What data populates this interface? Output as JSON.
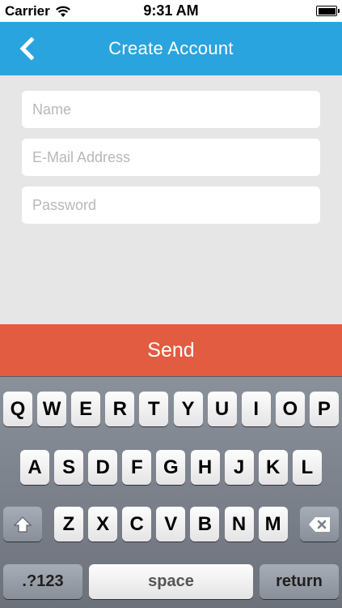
{
  "status_bar": {
    "carrier": "Carrier",
    "time": "9:31 AM",
    "wifi_icon": "wifi-icon",
    "battery_icon": "battery-icon",
    "battery_level": 1.0
  },
  "nav": {
    "title": "Create Account",
    "back_icon": "back-chevron-icon",
    "color": "#2aa4de"
  },
  "form": {
    "name": {
      "placeholder": "Name",
      "value": ""
    },
    "email": {
      "placeholder": "E-Mail Address",
      "value": ""
    },
    "password": {
      "placeholder": "Password",
      "value": ""
    }
  },
  "send_button": {
    "label": "Send",
    "color": "#e25c42"
  },
  "keyboard": {
    "row1": [
      "Q",
      "W",
      "E",
      "R",
      "T",
      "Y",
      "U",
      "I",
      "O",
      "P"
    ],
    "row2": [
      "A",
      "S",
      "D",
      "F",
      "G",
      "H",
      "J",
      "K",
      "L"
    ],
    "row3": [
      "Z",
      "X",
      "C",
      "V",
      "B",
      "N",
      "M"
    ],
    "shift_icon": "shift-arrow-icon",
    "delete_icon": "delete-backspace-icon",
    "numbers_label": ".?123",
    "space_label": "space",
    "return_label": "return"
  }
}
